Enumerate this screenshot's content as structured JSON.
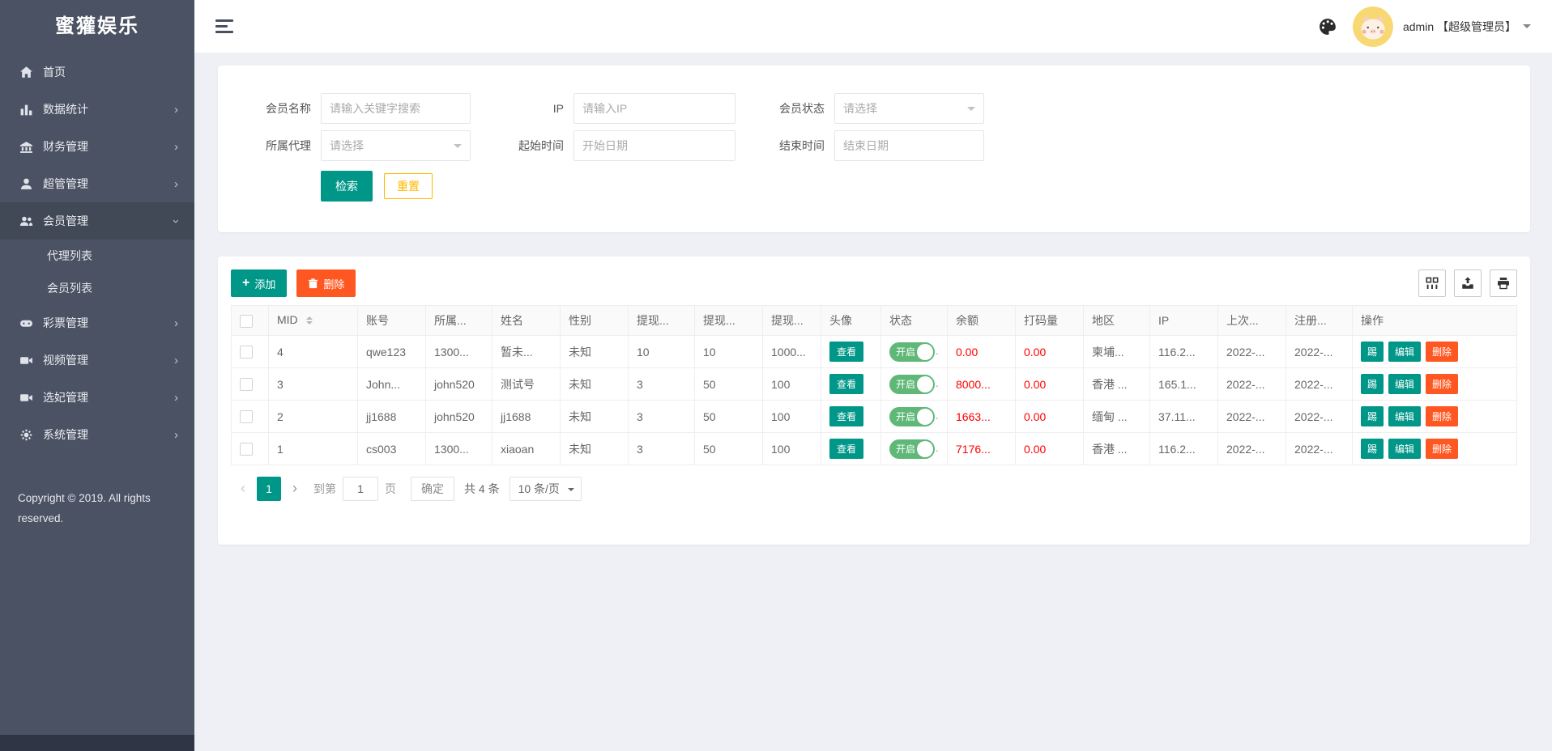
{
  "app": {
    "title": "蜜獾娱乐"
  },
  "header": {
    "username": "admin 【超级管理员】"
  },
  "sidebar": {
    "items": [
      {
        "label": "首页",
        "icon": "home-icon",
        "arrow": ""
      },
      {
        "label": "数据统计",
        "icon": "bar-chart-icon",
        "arrow": "right"
      },
      {
        "label": "财务管理",
        "icon": "bank-icon",
        "arrow": "right"
      },
      {
        "label": "超管管理",
        "icon": "user-icon",
        "arrow": "right"
      },
      {
        "label": "会员管理",
        "icon": "users-icon",
        "arrow": "down",
        "active": true,
        "children": [
          {
            "label": "代理列表"
          },
          {
            "label": "会员列表"
          }
        ]
      },
      {
        "label": "彩票管理",
        "icon": "gamepad-icon",
        "arrow": "right"
      },
      {
        "label": "视频管理",
        "icon": "video-icon",
        "arrow": "right"
      },
      {
        "label": "选妃管理",
        "icon": "video-icon",
        "arrow": "right"
      },
      {
        "label": "系统管理",
        "icon": "gear-icon",
        "arrow": "right"
      }
    ],
    "copyright": "Copyright © 2019. All rights reserved."
  },
  "search": {
    "fields": [
      {
        "label": "会员名称",
        "type": "input",
        "placeholder": "请输入关键字搜索"
      },
      {
        "label": "IP",
        "type": "input",
        "placeholder": "请输入IP"
      },
      {
        "label": "会员状态",
        "type": "select",
        "placeholder": "请选择"
      },
      {
        "label": "所属代理",
        "type": "select",
        "placeholder": "请选择"
      },
      {
        "label": "起始时间",
        "type": "input",
        "placeholder": "开始日期"
      },
      {
        "label": "结束时间",
        "type": "input",
        "placeholder": "结束日期"
      }
    ],
    "search_label": "检索",
    "reset_label": "重置"
  },
  "toolbar": {
    "add_label": "添加",
    "delete_label": "删除"
  },
  "table": {
    "headers": [
      "MID",
      "账号",
      "所属...",
      "姓名",
      "性别",
      "提现...",
      "提现...",
      "提现...",
      "头像",
      "状态",
      "余额",
      "打码量",
      "地区",
      "IP",
      "上次...",
      "注册...",
      "操作"
    ],
    "view_label": "查看",
    "status_on_label": "开启",
    "ops": [
      "踢",
      "编辑",
      "删除"
    ],
    "rows": [
      {
        "mid": "4",
        "account": "qwe123",
        "agent": "1300...",
        "name": "暂未...",
        "gender": "未知",
        "w_min": "10",
        "w_max": "10",
        "w_limit": "1000...",
        "balance": "0.00",
        "wager": "0.00",
        "region": "柬埔...",
        "ip": "116.2...",
        "last": "2022-...",
        "reg": "2022-..."
      },
      {
        "mid": "3",
        "account": "John...",
        "agent": "john520",
        "name": "测试号",
        "gender": "未知",
        "w_min": "3",
        "w_max": "50",
        "w_limit": "100",
        "balance": "8000...",
        "wager": "0.00",
        "region": "香港 ...",
        "ip": "165.1...",
        "last": "2022-...",
        "reg": "2022-..."
      },
      {
        "mid": "2",
        "account": "jj1688",
        "agent": "john520",
        "name": "jj1688",
        "gender": "未知",
        "w_min": "3",
        "w_max": "50",
        "w_limit": "100",
        "balance": "1663...",
        "wager": "0.00",
        "region": "缅甸 ...",
        "ip": "37.11...",
        "last": "2022-...",
        "reg": "2022-..."
      },
      {
        "mid": "1",
        "account": "cs003",
        "agent": "1300...",
        "name": "xiaoan",
        "gender": "未知",
        "w_min": "3",
        "w_max": "50",
        "w_limit": "100",
        "balance": "7176...",
        "wager": "0.00",
        "region": "香港 ...",
        "ip": "116.2...",
        "last": "2022-...",
        "reg": "2022-..."
      }
    ]
  },
  "pagination": {
    "prev": "‹",
    "page": "1",
    "next": "›",
    "goto_prefix": "到第",
    "goto_value": "1",
    "goto_suffix": "页",
    "confirm_label": "确定",
    "total": "共 4 条",
    "page_size": "10 条/页"
  },
  "colors": {
    "accent": "#009688",
    "danger": "#FF5722",
    "toggle_on": "#5FB878",
    "warning": "#FFB800",
    "value_red": "#FF0000",
    "sidebar_bg": "#4b5263"
  }
}
